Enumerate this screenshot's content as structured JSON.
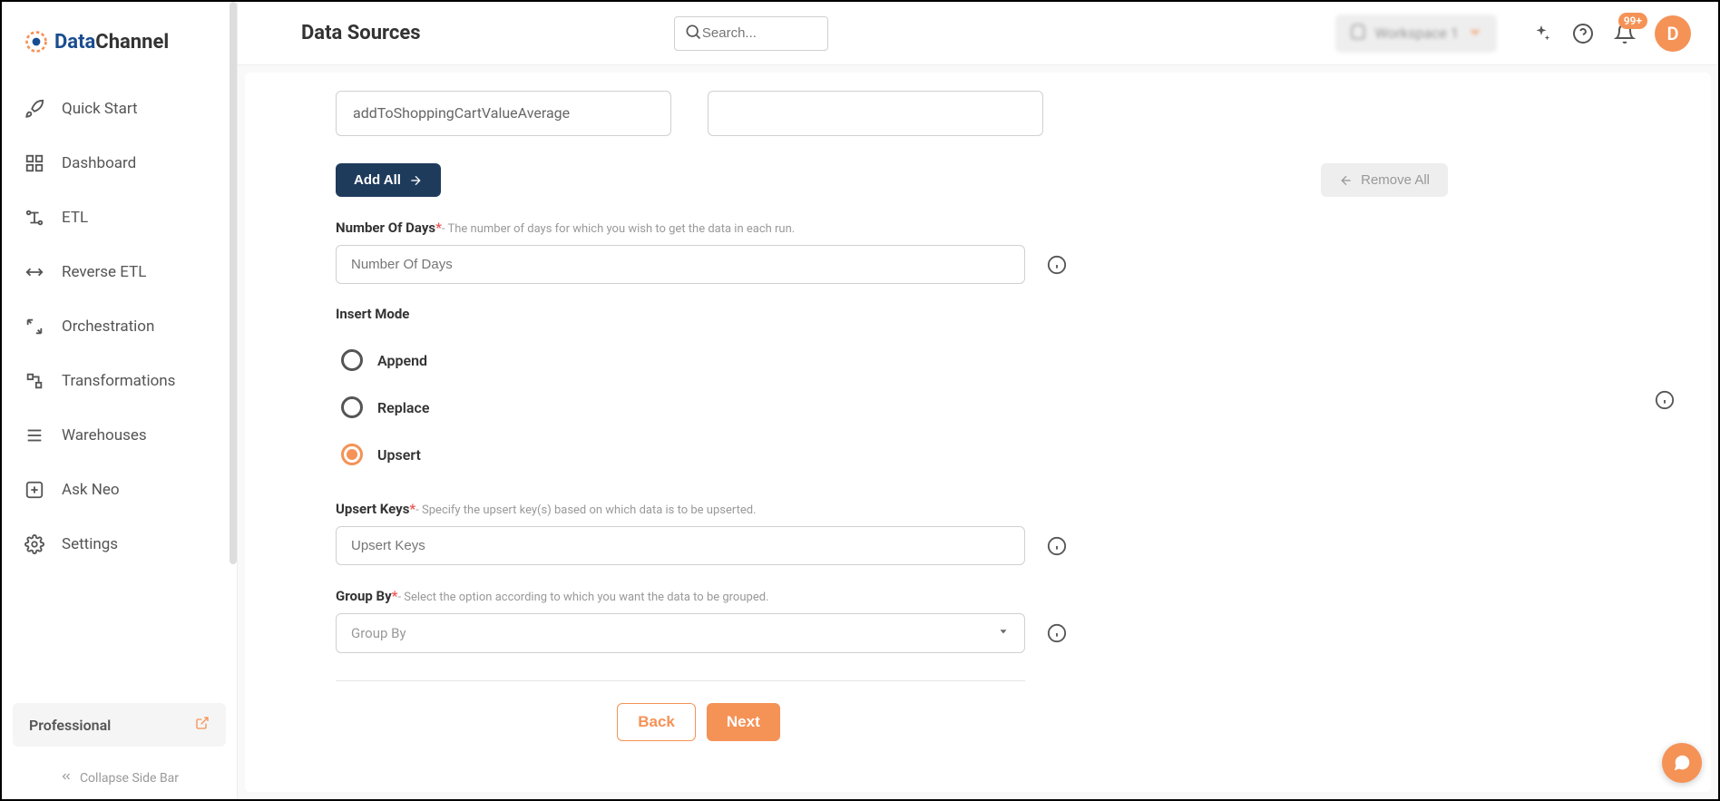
{
  "logo": {
    "brand1": "Data",
    "brand2": "Channel"
  },
  "sidebar": {
    "items": [
      {
        "label": "Quick Start"
      },
      {
        "label": "Dashboard"
      },
      {
        "label": "ETL"
      },
      {
        "label": "Reverse ETL"
      },
      {
        "label": "Orchestration"
      },
      {
        "label": "Transformations"
      },
      {
        "label": "Warehouses"
      },
      {
        "label": "Ask Neo"
      },
      {
        "label": "Settings"
      }
    ],
    "plan": "Professional",
    "collapse": "Collapse Side Bar"
  },
  "header": {
    "title": "Data Sources",
    "search_placeholder": "Search...",
    "workspace": "Workspace 1",
    "badge": "99+",
    "avatar": "D"
  },
  "form": {
    "chip": "addToShoppingCartValueAverage",
    "add_all": "Add All",
    "remove_all": "Remove All",
    "numdays": {
      "label": "Number Of Days",
      "hint": "- The number of days for which you wish to get the data in each run.",
      "placeholder": "Number Of Days"
    },
    "insert_mode": {
      "label": "Insert Mode",
      "options": [
        "Append",
        "Replace",
        "Upsert"
      ],
      "selected": "Upsert"
    },
    "upsert_keys": {
      "label": "Upsert Keys",
      "hint": "- Specify the upsert key(s) based on which data is to be upserted.",
      "placeholder": "Upsert Keys"
    },
    "group_by": {
      "label": "Group By",
      "hint": "- Select the option according to which you want the data to be grouped.",
      "placeholder": "Group By"
    },
    "back": "Back",
    "next": "Next"
  }
}
